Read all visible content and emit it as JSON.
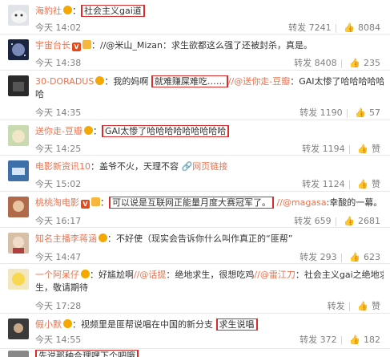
{
  "comments": [
    {
      "user": "海豹社",
      "sep": "：",
      "text": "社会主义gai道",
      "mention": "",
      "tail": "",
      "time": "今天 14:02",
      "repost": "转发 7241",
      "likes": "8084"
    },
    {
      "user": "宇宙台长",
      "sep": "：",
      "text": "//@米山_Mizan：求生欲都这么强了还被封杀，真是。",
      "mention": "",
      "tail": "",
      "time": "今天 14:38",
      "repost": "转发 8408",
      "likes": "235"
    },
    {
      "user": "30-DORADUS",
      "sep": "：",
      "text": "我的妈啊",
      "highlight": "就难赚屎难吃……",
      "mention": "//@送你走-豆瓣",
      "tail": "：GAI太惨了哈哈哈哈哈哈哈哈哈",
      "line2": "哈",
      "time": "今天 14:35",
      "repost": "转发 1190",
      "likes": "57"
    },
    {
      "user": "送你走-豆瓣",
      "sep": "：",
      "text": "",
      "highlight": "GAI太惨了哈哈哈哈哈哈哈哈哈",
      "mention": "",
      "tail": "",
      "time": "今天 14:25",
      "repost": "转发 1194",
      "likes": "赞"
    },
    {
      "user": "电影新资讯10",
      "sep": "：",
      "text": "盖爷不火，天理不容",
      "link": "网页链接",
      "time": "今天 15:02",
      "repost": "转发 1124",
      "likes": "赞"
    },
    {
      "user": "桃桃淘电影",
      "sep": "：",
      "text": "",
      "highlight": "可以说是互联网正能量月度大赛冠军了。",
      "mention": "//@magasa",
      "tail": ":幸酸的一幕。",
      "time": "今天 16:17",
      "repost": "转发 659",
      "likes": "2681"
    },
    {
      "user": "知名主播李蒋涵",
      "sep": "：",
      "text": "不好使（现实会告诉你什么叫作真正的“匪帮”",
      "mention": "",
      "tail": "",
      "time": "今天 14:47",
      "repost": "转发 293",
      "likes": "623"
    },
    {
      "user": "一个阿呆仔",
      "sep": "：",
      "text": "好尴尬啊",
      "mention": "//@话提",
      "tail": "：绝地求生，很想吃鸡",
      "mention2": "//@雷江刀",
      "tail2": "：社会主义gai之绝地求",
      "line2": "生，敬请期待",
      "time": "今天 17:28",
      "repost": "转发",
      "likes": "赞"
    },
    {
      "user": "假小默",
      "sep": "：",
      "text": "视频里是匪帮说唱在中国的新分支",
      "highlight": "求生说唱",
      "mention": "",
      "tail": "",
      "time": "今天 14:55",
      "repost": "转发 372",
      "likes": "182"
    },
    {
      "user": "",
      "sep": "",
      "text": "",
      "highlight": "先说那种合理嘿下个吧哦",
      "mention": "",
      "tail": "",
      "time": "",
      "repost": "",
      "likes": ""
    }
  ]
}
